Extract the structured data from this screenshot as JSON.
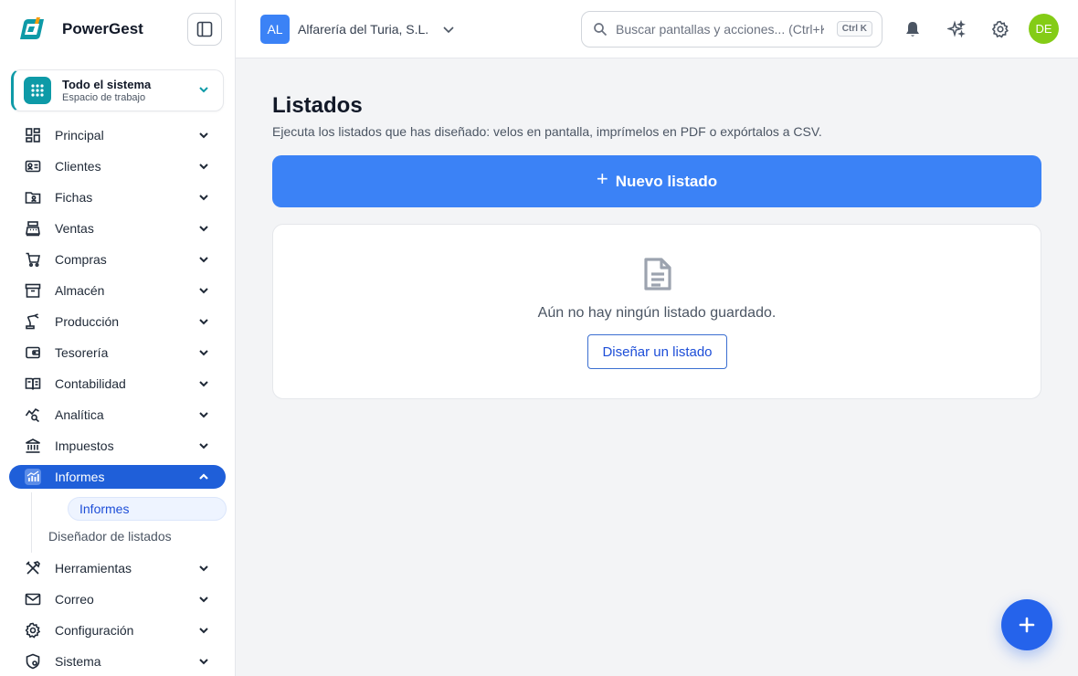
{
  "brand": {
    "name": "PowerGest"
  },
  "workspace": {
    "title": "Todo el sistema",
    "subtitle": "Espacio de trabajo"
  },
  "sidebar": {
    "items": [
      {
        "label": "Principal",
        "icon": "dashboard-icon"
      },
      {
        "label": "Clientes",
        "icon": "contact-card-icon"
      },
      {
        "label": "Fichas",
        "icon": "folder-user-icon"
      },
      {
        "label": "Ventas",
        "icon": "cash-register-icon"
      },
      {
        "label": "Compras",
        "icon": "cart-icon"
      },
      {
        "label": "Almacén",
        "icon": "archive-box-icon"
      },
      {
        "label": "Producción",
        "icon": "robot-arm-icon"
      },
      {
        "label": "Tesorería",
        "icon": "wallet-icon"
      },
      {
        "label": "Contabilidad",
        "icon": "open-book-icon"
      },
      {
        "label": "Analítica",
        "icon": "chart-search-icon"
      },
      {
        "label": "Impuestos",
        "icon": "bank-icon"
      },
      {
        "label": "Informes",
        "icon": "bar-chart-icon"
      },
      {
        "label": "Herramientas",
        "icon": "tools-icon"
      },
      {
        "label": "Correo",
        "icon": "mail-icon"
      },
      {
        "label": "Configuración",
        "icon": "gear-icon"
      },
      {
        "label": "Sistema",
        "icon": "shield-gear-icon"
      }
    ],
    "informes_sub": [
      {
        "label": "Informes"
      },
      {
        "label": "Diseñador de listados"
      }
    ]
  },
  "topbar": {
    "company_initials": "AL",
    "company_name": "Alfarería del Turia, S.L.",
    "search_placeholder": "Buscar pantallas y acciones... (Ctrl+K)",
    "search_shortcut": "Ctrl K",
    "avatar_initials": "DE"
  },
  "main": {
    "title": "Listados",
    "description": "Ejecuta los listados que has diseñado: velos en pantalla, imprímelos en PDF o expórtalos a CSV.",
    "new_button": "Nuevo listado",
    "empty_text": "Aún no hay ningún listado guardado.",
    "design_button": "Diseñar un listado"
  },
  "colors": {
    "accent": "#3b82f6",
    "active_nav": "#1f5fd9",
    "workspace": "#0e9aa7",
    "avatar": "#84cc16"
  }
}
